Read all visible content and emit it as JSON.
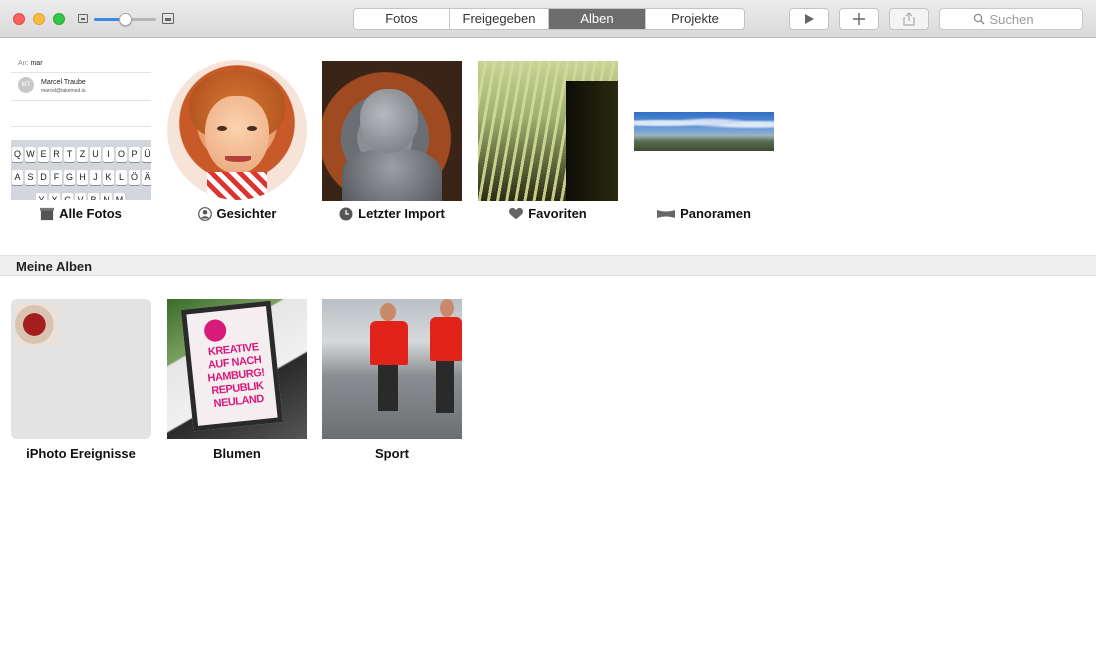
{
  "toolbar": {
    "zoom": {
      "level": 0.5
    },
    "tabs": [
      {
        "label": "Fotos",
        "active": false
      },
      {
        "label": "Freigegeben",
        "active": false
      },
      {
        "label": "Alben",
        "active": true
      },
      {
        "label": "Projekte",
        "active": false
      }
    ],
    "play_icon": "play-icon",
    "add_icon": "plus-icon",
    "share_icon": "share-icon",
    "search": {
      "placeholder": "Suchen",
      "value": "",
      "icon": "magnifier-icon"
    }
  },
  "smart_albums": [
    {
      "label": "Alle Fotos",
      "icon": "photos-stack-icon",
      "thumb": {
        "to_label": "An:",
        "to_value": "mar",
        "contact_initials": "MT",
        "contact_name": "Marcel Traube",
        "contact_email": "marcel@takemed.io",
        "keyboard_row1": [
          "Q",
          "W",
          "E",
          "R",
          "T",
          "Z",
          "U",
          "I",
          "O",
          "P",
          "Ü"
        ],
        "keyboard_row2": [
          "A",
          "S",
          "D",
          "F",
          "G",
          "H",
          "J",
          "K",
          "L",
          "Ö",
          "Ä"
        ],
        "keyboard_row3": [
          "Y",
          "X",
          "C",
          "V",
          "B",
          "N",
          "M"
        ]
      }
    },
    {
      "label": "Gesichter",
      "icon": "person-circle-icon"
    },
    {
      "label": "Letzter Import",
      "icon": "clock-icon"
    },
    {
      "label": "Favoriten",
      "icon": "heart-icon"
    },
    {
      "label": "Panoramen",
      "icon": "panorama-icon"
    }
  ],
  "section": {
    "title": "Meine Alben"
  },
  "albums": [
    {
      "label": "iPhoto Ereignisse"
    },
    {
      "label": "Blumen",
      "poster_lines": [
        "KREATIVE",
        "AUF NACH",
        "HAMBURG!",
        "REPUBLIK",
        "NEULAND"
      ]
    },
    {
      "label": "Sport"
    }
  ],
  "colors": {
    "accent": "#3d8ae6",
    "active_tab": "#6d6d6d",
    "section_bg": "#eeeeee"
  }
}
